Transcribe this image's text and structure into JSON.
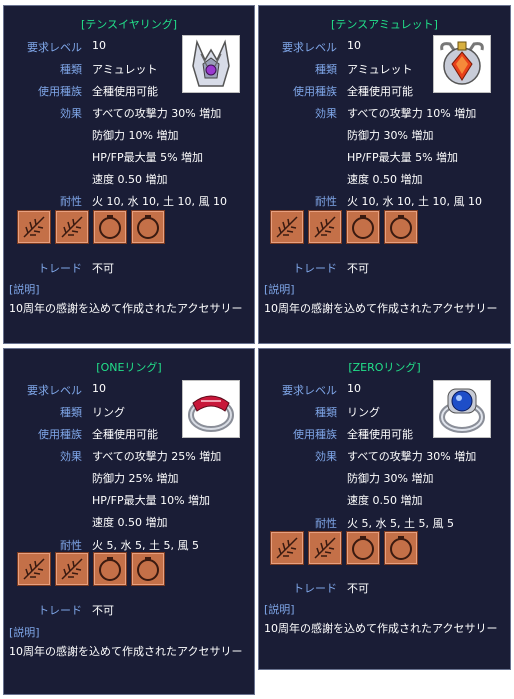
{
  "panels": [
    {
      "title": "[テンスイヤリング]",
      "rows": [
        {
          "label": "要求レベル",
          "value": "10"
        },
        {
          "label": "種類",
          "value": "アミュレット"
        },
        {
          "label": "使用種族",
          "value": "全種使用可能"
        },
        {
          "label": "効果",
          "value": "すべての攻撃力 30% 増加"
        },
        {
          "label": "",
          "value": "防御力 10% 増加"
        },
        {
          "label": "",
          "value": "HP/FP最大量 5% 増加"
        },
        {
          "label": "",
          "value": "速度 0.50 増加"
        },
        {
          "label": "耐性",
          "value": "火 10, 水 10, 土 10, 風 10"
        }
      ],
      "trade_label": "トレード",
      "trade_value": "不可",
      "desc_label": "[説明]",
      "desc_text": "10周年の感謝を込めて作成されたアクセサリー",
      "image_icon": "earring-icon"
    },
    {
      "title": "[テンスアミュレット]",
      "rows": [
        {
          "label": "要求レベル",
          "value": "10"
        },
        {
          "label": "種類",
          "value": "アミュレット"
        },
        {
          "label": "使用種族",
          "value": "全種使用可能"
        },
        {
          "label": "効果",
          "value": "すべての攻撃力 10% 増加"
        },
        {
          "label": "",
          "value": "防御力 30% 増加"
        },
        {
          "label": "",
          "value": "HP/FP最大量 5% 増加"
        },
        {
          "label": "",
          "value": "速度 0.50 増加"
        },
        {
          "label": "耐性",
          "value": "火 10, 水 10, 土 10, 風 10"
        }
      ],
      "trade_label": "トレード",
      "trade_value": "不可",
      "desc_label": "[説明]",
      "desc_text": "10周年の感謝を込めて作成されたアクセサリー",
      "image_icon": "amulet-icon"
    },
    {
      "title": "[ONEリング]",
      "rows": [
        {
          "label": "要求レベル",
          "value": "10"
        },
        {
          "label": "種類",
          "value": "リング"
        },
        {
          "label": "使用種族",
          "value": "全種使用可能"
        },
        {
          "label": "効果",
          "value": "すべての攻撃力 25% 増加"
        },
        {
          "label": "",
          "value": "防御力 25% 増加"
        },
        {
          "label": "",
          "value": "HP/FP最大量 10% 増加"
        },
        {
          "label": "",
          "value": "速度 0.50 増加"
        },
        {
          "label": "耐性",
          "value": "火 5, 水 5, 土 5, 風 5"
        }
      ],
      "trade_label": "トレード",
      "trade_value": "不可",
      "desc_label": "[説明]",
      "desc_text": "10周年の感謝を込めて作成されたアクセサリー",
      "image_icon": "red-ring-icon"
    },
    {
      "title": "[ZEROリング]",
      "rows": [
        {
          "label": "要求レベル",
          "value": "10"
        },
        {
          "label": "種類",
          "value": "リング"
        },
        {
          "label": "使用種族",
          "value": "全種使用可能"
        },
        {
          "label": "効果",
          "value": "すべての攻撃力 30% 増加"
        },
        {
          "label": "",
          "value": "防御力 30% 増加"
        },
        {
          "label": "",
          "value": "速度 0.50 増加"
        },
        {
          "label": "耐性",
          "value": "火 5, 水 5, 土 5, 風 5"
        }
      ],
      "trade_label": "トレード",
      "trade_value": "不可",
      "desc_label": "[説明]",
      "desc_text": "10周年の感謝を込めて作成されたアクセサリー",
      "image_icon": "blue-ring-icon"
    }
  ],
  "slot_icons": [
    "feather-slot-icon",
    "feather-slot-icon",
    "ring-slot-icon",
    "ring-slot-icon"
  ],
  "colors": {
    "panel_bg": "#1a1d36",
    "title": "#22e08a",
    "label": "#7fa6e8",
    "slot": "#c47048"
  }
}
